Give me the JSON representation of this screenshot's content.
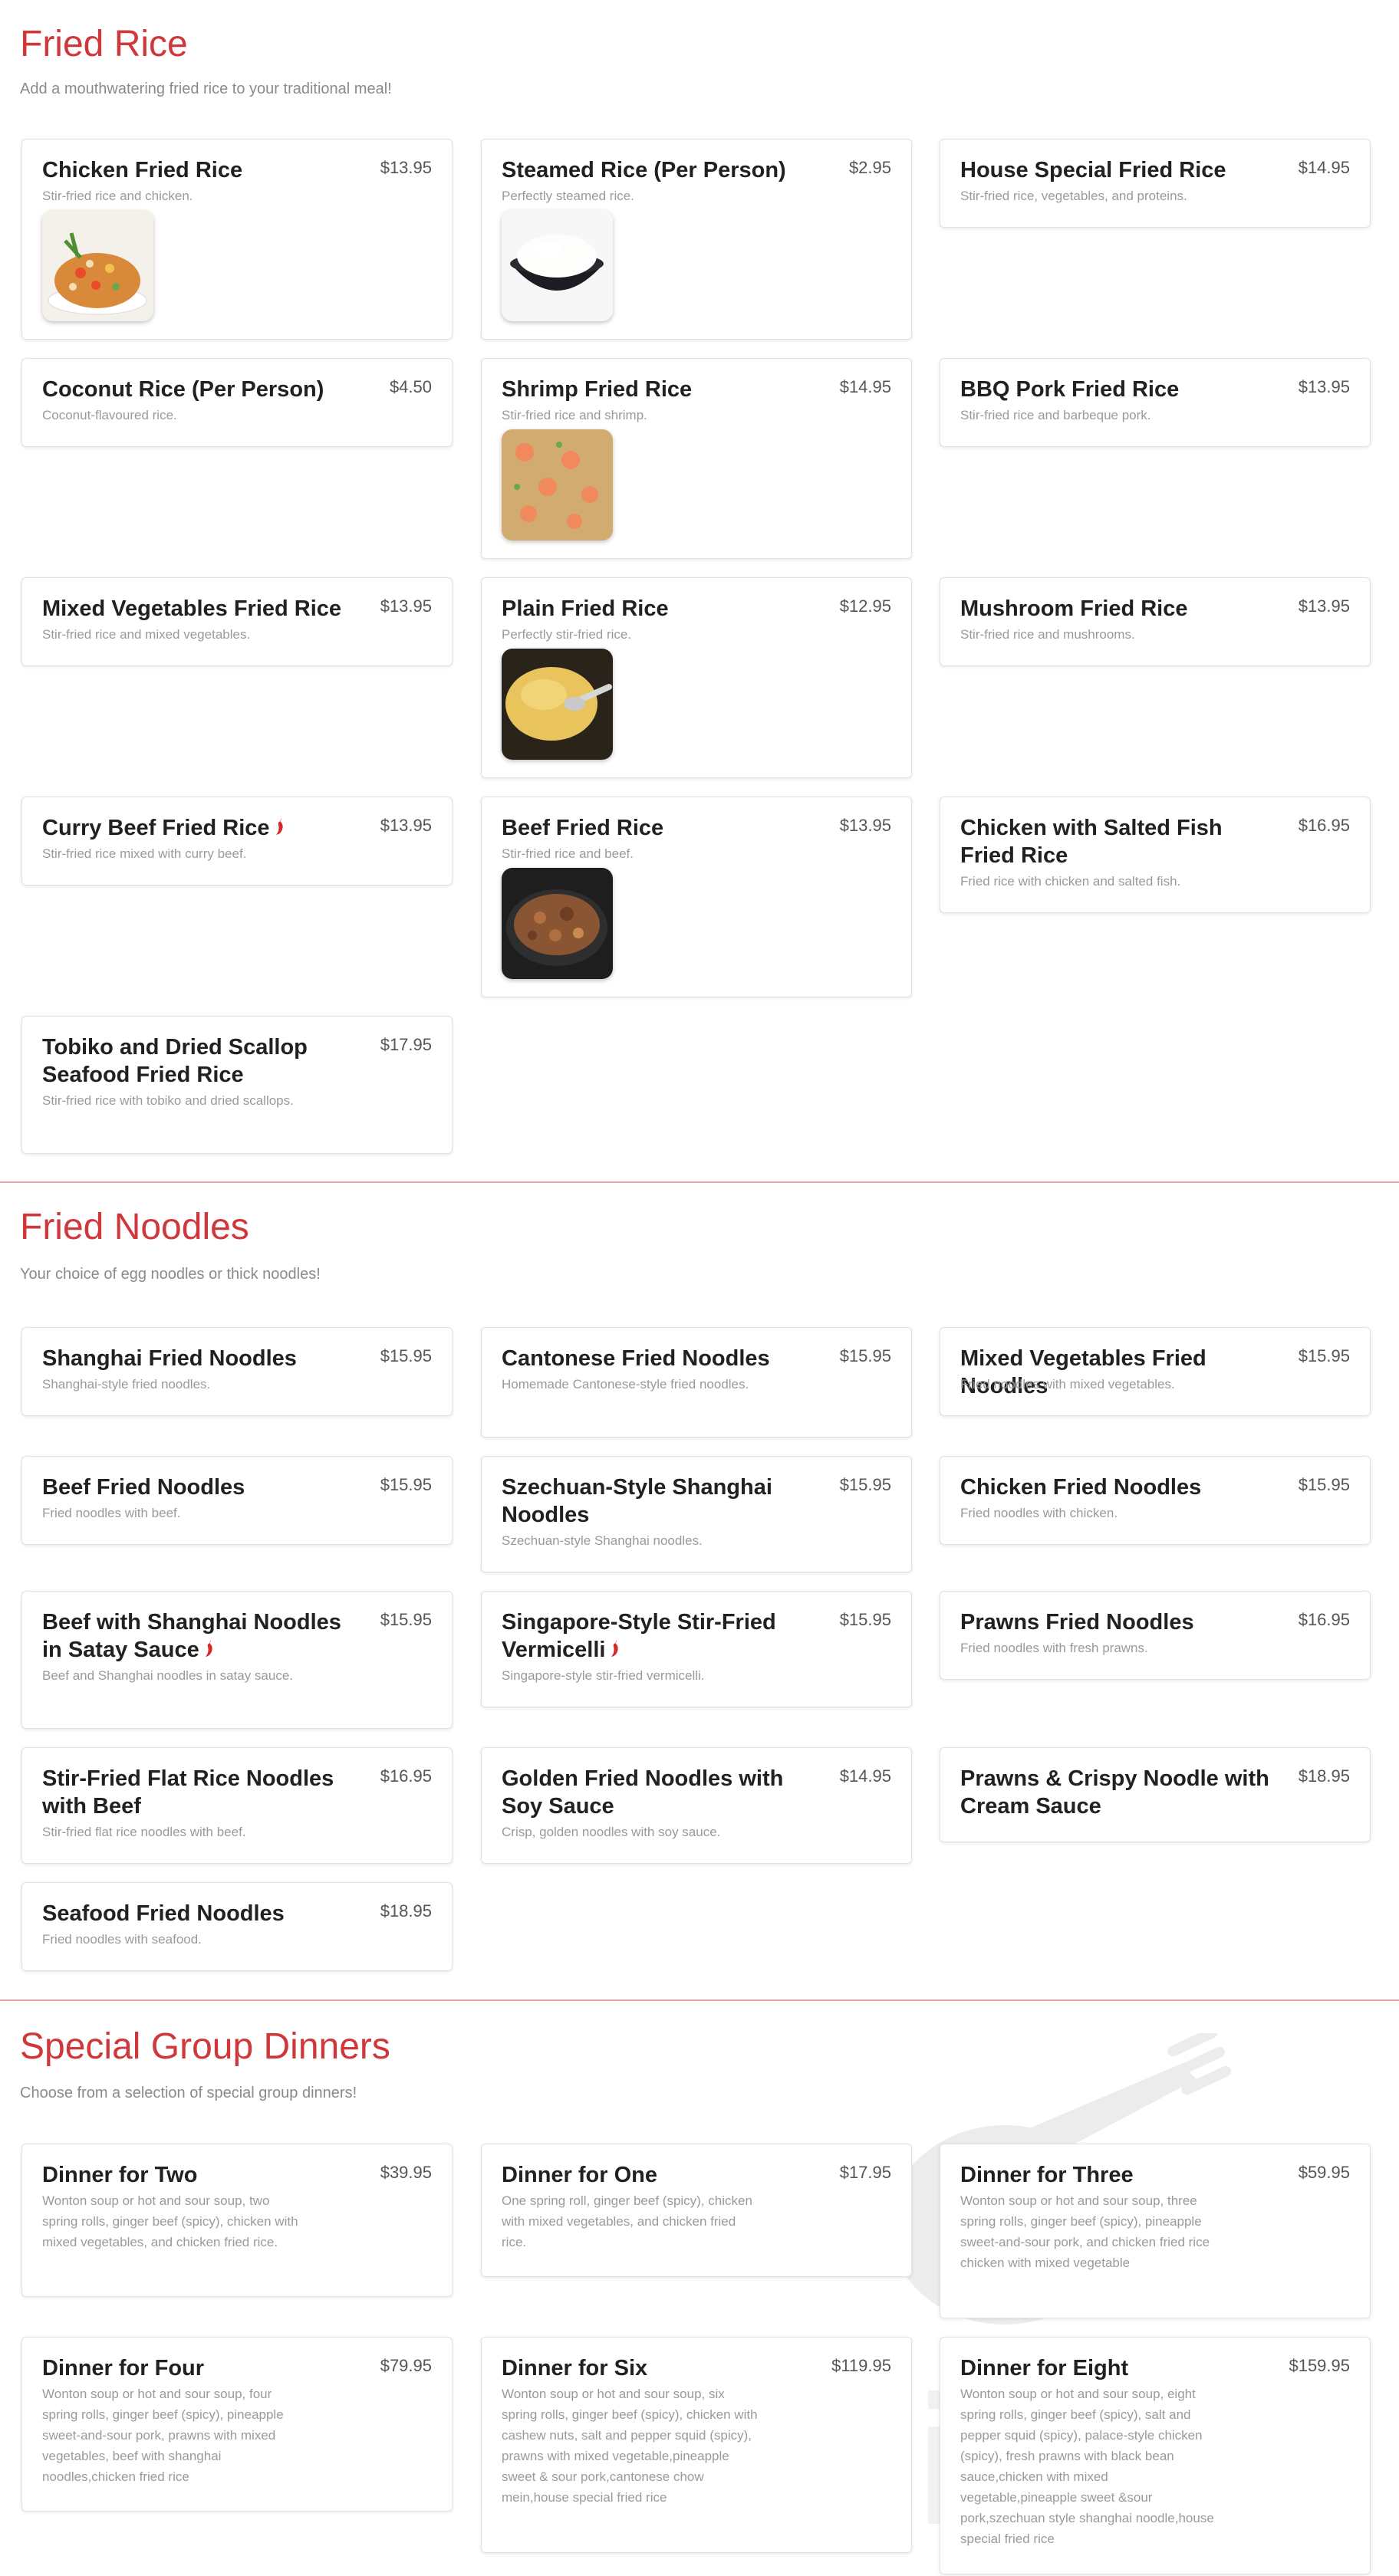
{
  "fried_rice": {
    "title": "Fried Rice",
    "subtitle": "Add a mouthwatering fried rice to your traditional meal!",
    "items": [
      {
        "name": "Chicken Fried Rice",
        "price": "$13.95",
        "desc": "Stir-fried rice and chicken."
      },
      {
        "name": "Steamed Rice (Per Person)",
        "price": "$2.95",
        "desc": "Perfectly steamed rice."
      },
      {
        "name": "House Special Fried Rice",
        "price": "$14.95",
        "desc": "Stir-fried rice, vegetables, and proteins."
      },
      {
        "name": "Coconut Rice (Per Person)",
        "price": "$4.50",
        "desc": "Coconut-flavoured rice."
      },
      {
        "name": "Shrimp Fried Rice",
        "price": "$14.95",
        "desc": "Stir-fried rice and shrimp."
      },
      {
        "name": "BBQ Pork Fried Rice",
        "price": "$13.95",
        "desc": "Stir-fried rice and barbeque pork."
      },
      {
        "name": "Mixed Vegetables Fried Rice",
        "price": "$13.95",
        "desc": "Stir-fried rice and mixed vegetables."
      },
      {
        "name": "Plain Fried Rice",
        "price": "$12.95",
        "desc": "Perfectly stir-fried rice."
      },
      {
        "name": "Mushroom Fried Rice",
        "price": "$13.95",
        "desc": "Stir-fried rice and mushrooms."
      },
      {
        "name": "Curry Beef Fried Rice",
        "price": "$13.95",
        "desc": "Stir-fried rice mixed with curry beef."
      },
      {
        "name": "Beef Fried Rice",
        "price": "$13.95",
        "desc": "Stir-fried rice and beef."
      },
      {
        "name": "Chicken with Salted Fish Fried Rice",
        "price": "$16.95",
        "desc": "Fried rice with chicken and salted fish."
      },
      {
        "name": "Tobiko and Dried Scallop Seafood Fried Rice",
        "price": "$17.95",
        "desc": "Stir-fried rice with tobiko and dried scallops."
      }
    ]
  },
  "fried_noodles": {
    "title": "Fried Noodles",
    "subtitle": "Your choice of egg noodles or thick noodles!",
    "items": [
      {
        "name": "Shanghai Fried Noodles",
        "price": "$15.95",
        "desc": "Shanghai-style fried noodles."
      },
      {
        "name": "Cantonese Fried Noodles",
        "price": "$15.95",
        "desc": "Homemade Cantonese-style fried noodles."
      },
      {
        "name": "Mixed Vegetables Fried Noodles",
        "price": "$15.95",
        "desc": "Fried noodles with mixed vegetables."
      },
      {
        "name": "Beef Fried Noodles",
        "price": "$15.95",
        "desc": "Fried noodles with beef."
      },
      {
        "name": "Szechuan-Style Shanghai Noodles",
        "price": "$15.95",
        "desc": "Szechuan-style Shanghai noodles."
      },
      {
        "name": "Chicken Fried Noodles",
        "price": "$15.95",
        "desc": "Fried noodles with chicken."
      },
      {
        "name": "Beef with Shanghai Noodles in Satay Sauce",
        "price": "$15.95",
        "desc": "Beef and Shanghai noodles in satay sauce."
      },
      {
        "name": "Singapore-Style Stir-Fried Vermicelli",
        "price": "$15.95",
        "desc": "Singapore-style stir-fried vermicelli."
      },
      {
        "name": "Prawns Fried Noodles",
        "price": "$16.95",
        "desc": "Fried noodles with fresh prawns."
      },
      {
        "name": "Stir-Fried Flat Rice Noodles with Beef",
        "price": "$16.95",
        "desc": "Stir-fried flat rice noodles with beef."
      },
      {
        "name": "Golden Fried Noodles with Soy Sauce",
        "price": "$14.95",
        "desc": "Crisp, golden noodles with soy sauce."
      },
      {
        "name": "Prawns & Crispy Noodle with Cream Sauce",
        "price": "$18.95",
        "desc": ""
      },
      {
        "name": "Seafood Fried Noodles",
        "price": "$18.95",
        "desc": "Fried noodles with seafood."
      }
    ]
  },
  "group_dinners": {
    "title": "Special Group Dinners",
    "subtitle": "Choose from a selection of special group dinners!",
    "items": [
      {
        "name": "Dinner for Two",
        "price": "$39.95",
        "desc": "Wonton soup or hot and sour soup, two spring rolls, ginger beef (spicy), chicken with mixed vegetables, and chicken fried rice."
      },
      {
        "name": "Dinner for One",
        "price": "$17.95",
        "desc": "One spring roll, ginger beef (spicy), chicken with mixed vegetables, and chicken fried rice."
      },
      {
        "name": "Dinner for Three",
        "price": "$59.95",
        "desc": "Wonton soup or hot and sour soup, three spring rolls, ginger beef (spicy), pineapple sweet-and-sour pork, and chicken fried rice chicken with mixed vegetable"
      },
      {
        "name": "Dinner for Four",
        "price": "$79.95",
        "desc": "Wonton soup or hot and sour soup, four spring rolls, ginger beef (spicy), pineapple sweet-and-sour pork, prawns with mixed vegetables, beef with shanghai noodles,chicken fried rice"
      },
      {
        "name": "Dinner for Six",
        "price": "$119.95",
        "desc": "Wonton soup or hot and sour soup, six spring rolls, ginger beef (spicy), chicken with cashew nuts, salt and pepper squid (spicy), prawns with mixed vegetable,pineapple sweet & sour pork,cantonese chow mein,house special fried rice"
      },
      {
        "name": "Dinner for Eight",
        "price": "$159.95",
        "desc": "Wonton soup or hot and sour soup, eight spring rolls, ginger beef (spicy), salt and pepper squid (spicy), palace-style chicken (spicy), fresh prawns with black bean sauce,chicken with mixed vegetable,pineapple sweet &sour pork,szechuan style shanghai noodle,house special fried rice"
      }
    ]
  },
  "watermark_text": "sirved",
  "colors": {
    "accent": "#d0373a",
    "divider": "#e8a3ab",
    "spicy": "#d42a2a"
  },
  "icons": {
    "spicy": "chili-pepper-icon",
    "watermark": "fork-plate-icon"
  }
}
